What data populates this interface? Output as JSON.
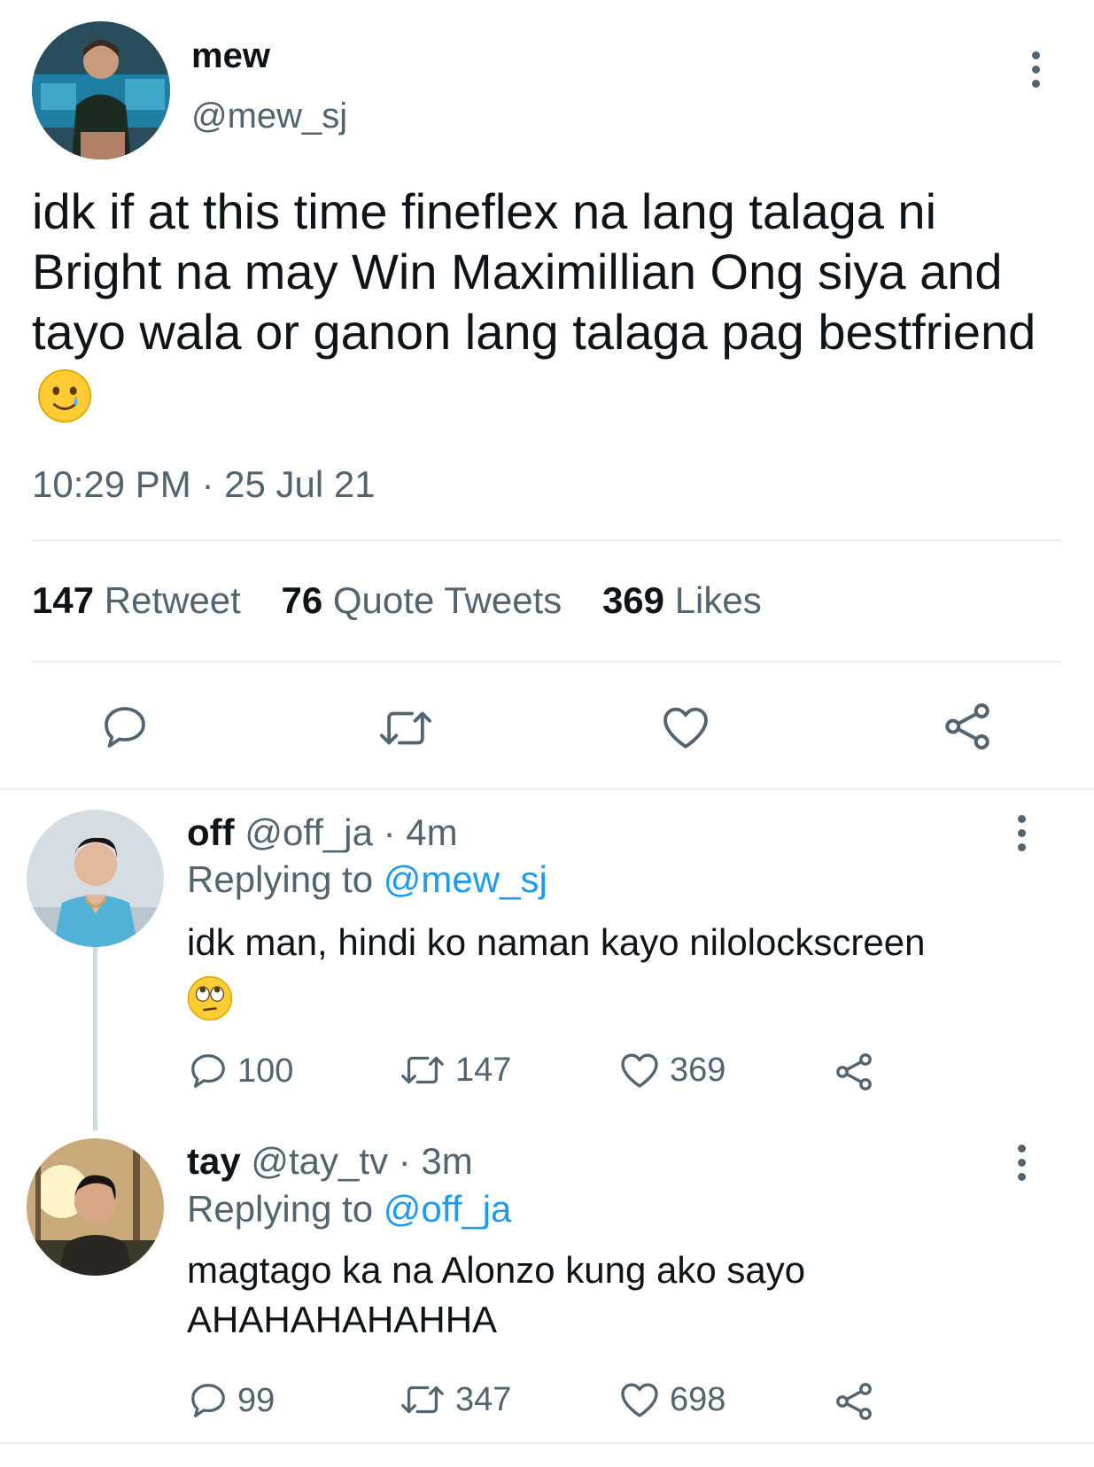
{
  "main_tweet": {
    "display_name": "mew",
    "handle": "@mew_sj",
    "text": "idk if at this time fineflex na lang talaga ni Bright na may Win Maximillian Ong siya and tayo wala or ganon lang talaga pag bestfriend",
    "emoji": "smiling-face-with-tear",
    "time": "10:29 PM",
    "date": "25 Jul 21",
    "stats": {
      "retweets_count": "147",
      "retweets_label": "Retweet",
      "quotes_count": "76",
      "quotes_label": "Quote Tweets",
      "likes_count": "369",
      "likes_label": "Likes"
    }
  },
  "replies": [
    {
      "display_name": "off",
      "handle": "@off_ja",
      "age": "4m",
      "replying_prefix": "Replying to",
      "replying_to": "@mew_sj",
      "text": "idk man, hindi ko naman kayo nilolockscreen",
      "emoji": "face-with-rolling-eyes",
      "replies": "100",
      "retweets": "147",
      "likes": "369"
    },
    {
      "display_name": "tay",
      "handle": "@tay_tv",
      "age": "3m",
      "replying_prefix": "Replying to",
      "replying_to": "@off_ja",
      "text": "magtago ka na Alonzo kung ako sayo AHAHAHAHAHHA",
      "replies": "99",
      "retweets": "347",
      "likes": "698"
    }
  ],
  "colors": {
    "text": "#0f1419",
    "muted": "#536471",
    "link": "#1d9bf0",
    "divider": "#e6ecf0"
  }
}
